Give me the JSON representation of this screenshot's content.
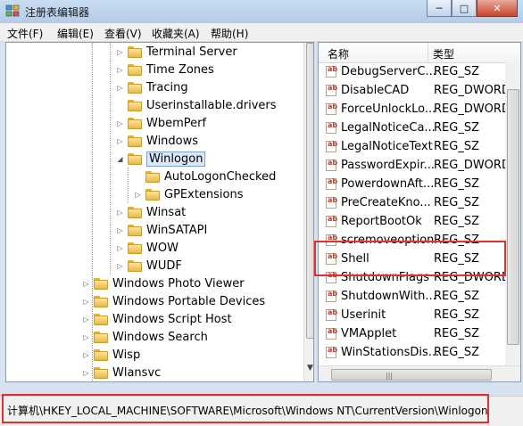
{
  "window": {
    "title": "注册表编辑器",
    "minimize_glyph": "─",
    "maximize_glyph": "□",
    "close_glyph": "✕"
  },
  "menu": [
    "文件(F)",
    "编辑(E)",
    "查看(V)",
    "收藏夹(A)",
    "帮助(H)"
  ],
  "tree": [
    {
      "label": "Terminal Server",
      "expander": "▷"
    },
    {
      "label": "Time Zones",
      "expander": "▷"
    },
    {
      "label": "Tracing",
      "expander": "▷"
    },
    {
      "label": "Userinstallable.drivers",
      "expander": ""
    },
    {
      "label": "WbemPerf",
      "expander": "▷"
    },
    {
      "label": "Windows",
      "expander": "▷"
    },
    {
      "label": "Winlogon",
      "expander": "◢",
      "selected": true
    },
    {
      "label": "AutoLogonChecked",
      "expander": ""
    },
    {
      "label": "GPExtensions",
      "expander": "▷"
    },
    {
      "label": "Winsat",
      "expander": "▷"
    },
    {
      "label": "WinSATAPI",
      "expander": "▷"
    },
    {
      "label": "WOW",
      "expander": "▷"
    },
    {
      "label": "WUDF",
      "expander": "▷"
    },
    {
      "label": "Windows Photo Viewer",
      "expander": "▷"
    },
    {
      "label": "Windows Portable Devices",
      "expander": "▷"
    },
    {
      "label": "Windows Script Host",
      "expander": "▷"
    },
    {
      "label": "Windows Search",
      "expander": "▷"
    },
    {
      "label": "Wisp",
      "expander": "▷"
    },
    {
      "label": "Wlansvc",
      "expander": "▷"
    }
  ],
  "list": {
    "col_name": "名称",
    "col_type": "类型",
    "rows": [
      {
        "name": "DebugServerC...",
        "type": "REG_SZ"
      },
      {
        "name": "DisableCAD",
        "type": "REG_DWORD"
      },
      {
        "name": "ForceUnlockLo...",
        "type": "REG_DWORD"
      },
      {
        "name": "LegalNoticeCa...",
        "type": "REG_SZ"
      },
      {
        "name": "LegalNoticeText",
        "type": "REG_SZ"
      },
      {
        "name": "PasswordExpir...",
        "type": "REG_DWORD"
      },
      {
        "name": "PowerdownAft...",
        "type": "REG_SZ"
      },
      {
        "name": "PreCreateKno...",
        "type": "REG_SZ"
      },
      {
        "name": "ReportBootOk",
        "type": "REG_SZ"
      },
      {
        "name": "scremoveoption",
        "type": "REG_SZ"
      },
      {
        "name": "Shell",
        "type": "REG_SZ",
        "highlighted": true
      },
      {
        "name": "ShutdownFlags",
        "type": "REG_DWORD"
      },
      {
        "name": "ShutdownWith...",
        "type": "REG_SZ"
      },
      {
        "name": "Userinit",
        "type": "REG_SZ"
      },
      {
        "name": "VMApplet",
        "type": "REG_SZ"
      },
      {
        "name": "WinStationsDis...",
        "type": "REG_SZ"
      }
    ]
  },
  "status": {
    "path": "计算机\\HKEY_LOCAL_MACHINE\\SOFTWARE\\Microsoft\\Windows NT\\CurrentVersion\\Winlogon"
  },
  "colors": {
    "highlight_box": "#e03030",
    "selection": "#dbe8f8"
  }
}
